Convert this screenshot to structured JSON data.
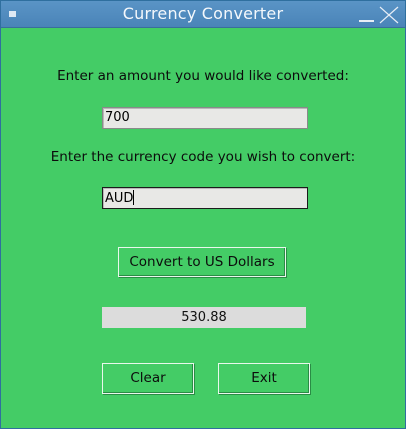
{
  "window": {
    "title": "Currency Converter"
  },
  "form": {
    "amount_prompt": "Enter an amount you would like converted:",
    "amount_value": "700",
    "code_prompt": "Enter the currency code you wish to convert:",
    "code_value": "AUD"
  },
  "buttons": {
    "convert_label": "Convert to US Dollars",
    "clear_label": "Clear",
    "exit_label": "Exit"
  },
  "result": {
    "value": "530.88"
  },
  "colors": {
    "background": "#44cc66",
    "titlebar": "#4f8bbf",
    "entry": "#e8e8e6",
    "result": "#dcdcdc"
  },
  "icons": {
    "menu": "window-menu-icon",
    "minimize": "minimize-icon",
    "close": "close-icon"
  }
}
